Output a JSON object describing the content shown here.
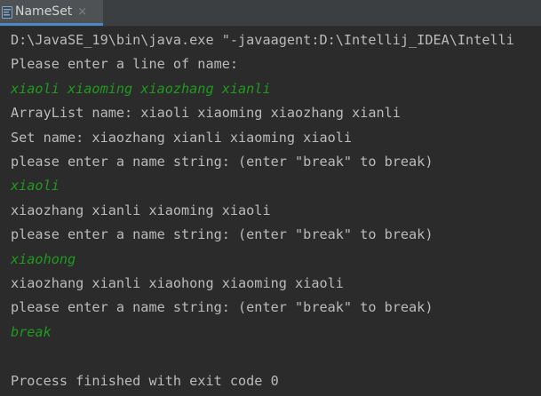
{
  "tab": {
    "title": "NameSet",
    "close_glyph": "×"
  },
  "console": {
    "lines": [
      {
        "text": "D:\\JavaSE_19\\bin\\java.exe \"-javaagent:D:\\Intellij_IDEA\\Intelli",
        "kind": "output"
      },
      {
        "text": "Please enter a line of name:",
        "kind": "output"
      },
      {
        "text": "xiaoli xiaoming xiaozhang xianli",
        "kind": "input"
      },
      {
        "text": "ArrayList name: xiaoli xiaoming xiaozhang xianli",
        "kind": "output"
      },
      {
        "text": "Set name: xiaozhang xianli xiaoming xiaoli",
        "kind": "output"
      },
      {
        "text": "please enter a name string: (enter \"break\" to break)",
        "kind": "output"
      },
      {
        "text": "xiaoli",
        "kind": "input"
      },
      {
        "text": "xiaozhang xianli xiaoming xiaoli",
        "kind": "output"
      },
      {
        "text": "please enter a name string: (enter \"break\" to break)",
        "kind": "output"
      },
      {
        "text": "xiaohong",
        "kind": "input"
      },
      {
        "text": "xiaozhang xianli xiaohong xiaoming xiaoli",
        "kind": "output"
      },
      {
        "text": "please enter a name string: (enter \"break\" to break)",
        "kind": "output"
      },
      {
        "text": "break",
        "kind": "input"
      },
      {
        "text": "",
        "kind": "output"
      },
      {
        "text": "Process finished with exit code 0",
        "kind": "output"
      }
    ]
  },
  "colors": {
    "background": "#2b2b2b",
    "output_text": "#bbbbbb",
    "input_text": "#1f9a1f",
    "tab_active": "#4e5254",
    "tab_underline": "#4a88c7"
  },
  "icons": {
    "tab_icon": "run-console-icon"
  }
}
